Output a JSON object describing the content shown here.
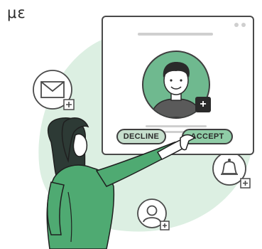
{
  "header": {
    "label": "με"
  },
  "card": {
    "decline_label": "DECLINE",
    "accept_label": "ACCEPT",
    "add_symbol": "+"
  },
  "icons": {
    "mail": "mail-icon",
    "bell": "bell-icon",
    "user": "user-icon",
    "add": "plus-icon"
  },
  "colors": {
    "accent_green": "#6fb98f",
    "soft_green": "#dcefe2",
    "button_green": "#8fcca6",
    "outline": "#3f3f3f"
  }
}
